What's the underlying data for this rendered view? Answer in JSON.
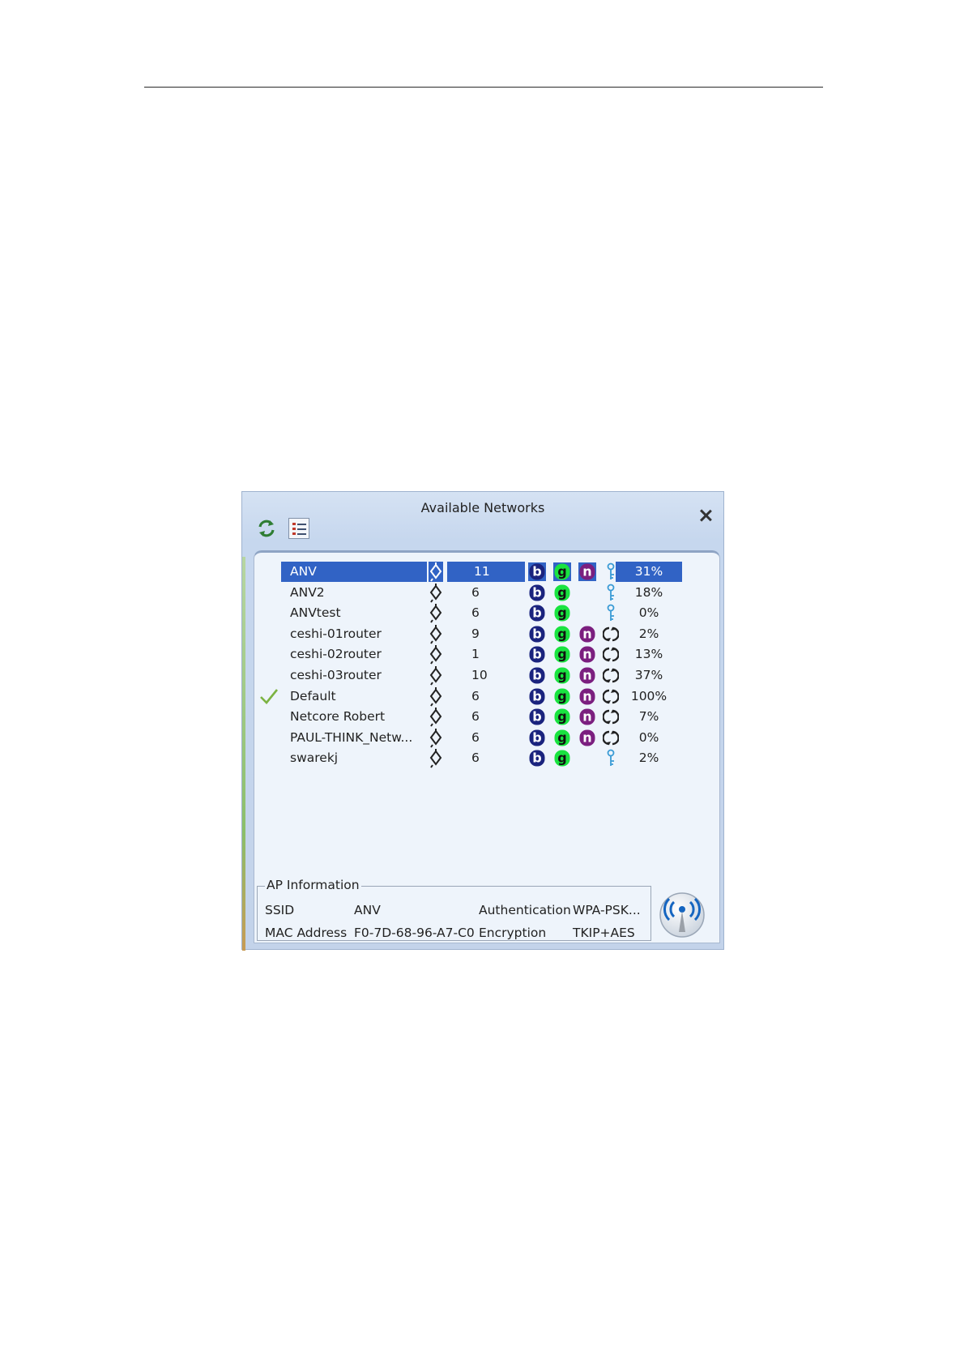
{
  "window": {
    "title": "Available Networks"
  },
  "networks": [
    {
      "ssid": "ANV",
      "channel": "11",
      "b": true,
      "g": true,
      "n": true,
      "extra": "key",
      "signal": "31%",
      "selected": true,
      "connected": false
    },
    {
      "ssid": "ANV2",
      "channel": "6",
      "b": true,
      "g": true,
      "n": false,
      "extra": "key",
      "signal": "18%",
      "selected": false,
      "connected": false
    },
    {
      "ssid": "ANVtest",
      "channel": "6",
      "b": true,
      "g": true,
      "n": false,
      "extra": "key",
      "signal": "0%",
      "selected": false,
      "connected": false
    },
    {
      "ssid": "ceshi-01router",
      "channel": "9",
      "b": true,
      "g": true,
      "n": true,
      "extra": "wps",
      "signal": "2%",
      "selected": false,
      "connected": false
    },
    {
      "ssid": "ceshi-02router",
      "channel": "1",
      "b": true,
      "g": true,
      "n": true,
      "extra": "wps",
      "signal": "13%",
      "selected": false,
      "connected": false
    },
    {
      "ssid": "ceshi-03router",
      "channel": "10",
      "b": true,
      "g": true,
      "n": true,
      "extra": "wps",
      "signal": "37%",
      "selected": false,
      "connected": false
    },
    {
      "ssid": "Default",
      "channel": "6",
      "b": true,
      "g": true,
      "n": true,
      "extra": "wps",
      "signal": "100%",
      "selected": false,
      "connected": true
    },
    {
      "ssid": "Netcore Robert",
      "channel": "6",
      "b": true,
      "g": true,
      "n": true,
      "extra": "wps",
      "signal": "7%",
      "selected": false,
      "connected": false
    },
    {
      "ssid": "PAUL-THINK_Netw...",
      "channel": "6",
      "b": true,
      "g": true,
      "n": true,
      "extra": "wps",
      "signal": "0%",
      "selected": false,
      "connected": false
    },
    {
      "ssid": "swarekj",
      "channel": "6",
      "b": true,
      "g": true,
      "n": false,
      "extra": "key",
      "signal": "2%",
      "selected": false,
      "connected": false
    }
  ],
  "ap_info": {
    "legend": "AP Information",
    "ssid_label": "SSID",
    "ssid_value": "ANV",
    "mac_label": "MAC Address",
    "mac_value": "F0-7D-68-96-A7-C0",
    "auth_label": "Authentication",
    "auth_value": "WPA-PSK...",
    "enc_label": "Encryption",
    "enc_value": "TKIP+AES"
  },
  "icons": {
    "refresh": "refresh-icon",
    "list": "list-view-icon",
    "close": "close-icon",
    "wifi": "wifi-signal-icon"
  },
  "colors": {
    "selection": "#3163c5",
    "mode_b": "#1a237e",
    "mode_g": "#19e340",
    "mode_n": "#7b1f7f",
    "key": "#3a9bd5"
  }
}
